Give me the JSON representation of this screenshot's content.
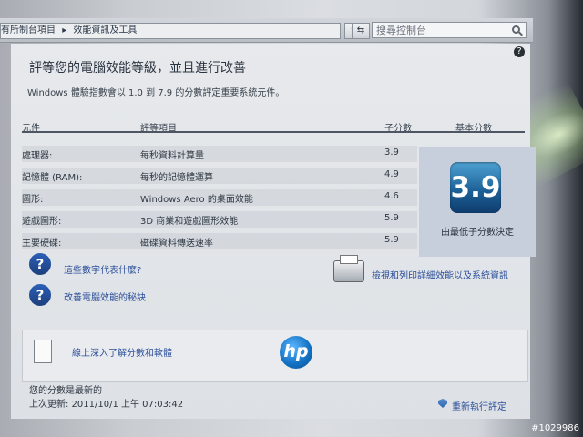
{
  "breadcrumb": [
    "有所制台項目",
    "效能資訊及工具"
  ],
  "search": {
    "placeholder": "搜尋控制台"
  },
  "title": "評等您的電腦效能等級，並且進行改善",
  "subtitle": "Windows 體驗指數會以 1.0 到 7.9 的分數評定重要系統元件。",
  "table": {
    "headers": [
      "元件",
      "評等項目",
      "子分數",
      "基本分數"
    ],
    "rows": [
      {
        "component": "處理器:",
        "item": "每秒資料計算量",
        "score": "3.9"
      },
      {
        "component": "記憶體 (RAM):",
        "item": "每秒的記憶體運算",
        "score": "4.9"
      },
      {
        "component": "圖形:",
        "item": "Windows Aero 的桌面效能",
        "score": "4.6"
      },
      {
        "component": "遊戲圖形:",
        "item": "3D 商業和遊戲圖形效能",
        "score": "5.9"
      },
      {
        "component": "主要硬碟:",
        "item": "磁碟資料傳送速率",
        "score": "5.9"
      }
    ],
    "base_score": "3.9",
    "base_note": "由最低子分數決定"
  },
  "links": {
    "what_mean": "這些數字代表什麼?",
    "improve": "改善電腦效能的秘訣",
    "print": "檢視和列印詳細效能以及系統資訊",
    "learn_more": "線上深入了解分數和軟體"
  },
  "status": {
    "line1": "您的分數是最新的",
    "line2": "上次更新: 2011/10/1 上午 07:03:42"
  },
  "rerun": "重新執行評定",
  "watermark": "#1029986",
  "icons": {
    "help": "question-icon",
    "shield": "shield-icon",
    "printer": "printer-icon",
    "logo": "hp-logo"
  },
  "colors": {
    "accent": "#2b4f9a",
    "score_tile": "#1d6299"
  }
}
